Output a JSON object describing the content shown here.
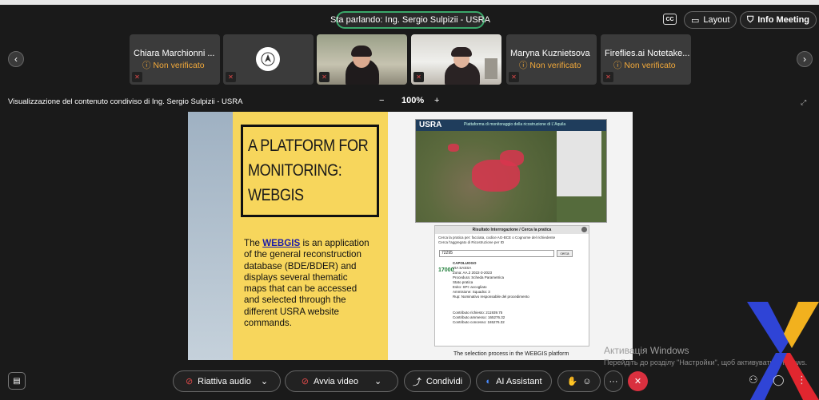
{
  "top": {
    "speaking": "Sta parlando: Ing. Sergio Sulpizii - USRA",
    "cc": "CC",
    "layout": "Layout",
    "info": "Info Meeting"
  },
  "participants": [
    {
      "name": "Chiara Marchionni ...",
      "status": "Non verificato"
    },
    {
      "name": "",
      "status": ""
    },
    {
      "name": "",
      "status": ""
    },
    {
      "name": "",
      "status": ""
    },
    {
      "name": "Maryna Kuznietsova",
      "status": "Non verificato"
    },
    {
      "name": "Fireflies.ai Notetake...",
      "status": "Non verificato"
    }
  ],
  "share": {
    "label": "Visualizzazione del contenuto condiviso di Ing. Sergio Sulpizii - USRA",
    "zoom_minus": "−",
    "zoom_value": "100%",
    "zoom_plus": "+"
  },
  "slide": {
    "title_lines": [
      "A PLATFORM FOR",
      "MONITORING:",
      "WEBGIS"
    ],
    "desc_prefix": "The ",
    "desc_link": "WEBGIS",
    "desc_rest": " is an application of the general reconstruction database (BDE/BDER) and displays several thematic maps that can be accessed and selected through the different USRA website commands.",
    "map_logo": "USRA",
    "map_header": "Piattaforma di monitoraggio della ricostruzione di L'Aquila",
    "panel_title": "Risultato Interrogazione / Cerca la pratica",
    "panel_sub1": "Cerca la pratica per: facciata, codice AG-BCE o Cognome del richiedente",
    "panel_sub2": "Cerca l'aggregato di Ricostruzione per ID",
    "panel_input": "72295",
    "panel_btn": "cerca",
    "panel_num": "17000",
    "panel_lines": [
      "CAPOLUOGO",
      "VIA SASSA",
      "Zona: AA.2 2022-3-2023",
      "Procedura: Scheda Parametrica",
      "Stato pratica",
      "Esito: SPI: accogliato",
      "Ammisione: Squadra: 3",
      "Rup: Nominativo responsabile del procedimento",
      "Contributo richiesto: 211939.75",
      "Contributo ammesso: 165276.32",
      "Contributo concesso: 165276.32"
    ],
    "caption": "The selection process in the WEBGIS platform"
  },
  "watermark": {
    "title": "Активація Windows",
    "sub": "Перейдіть до розділу \"Настройки\", щоб активувати Windows."
  },
  "controls": {
    "audio": "Riattiva audio",
    "video": "Avvia video",
    "share": "Condividi",
    "ai": "AI Assistant",
    "more": "···"
  }
}
